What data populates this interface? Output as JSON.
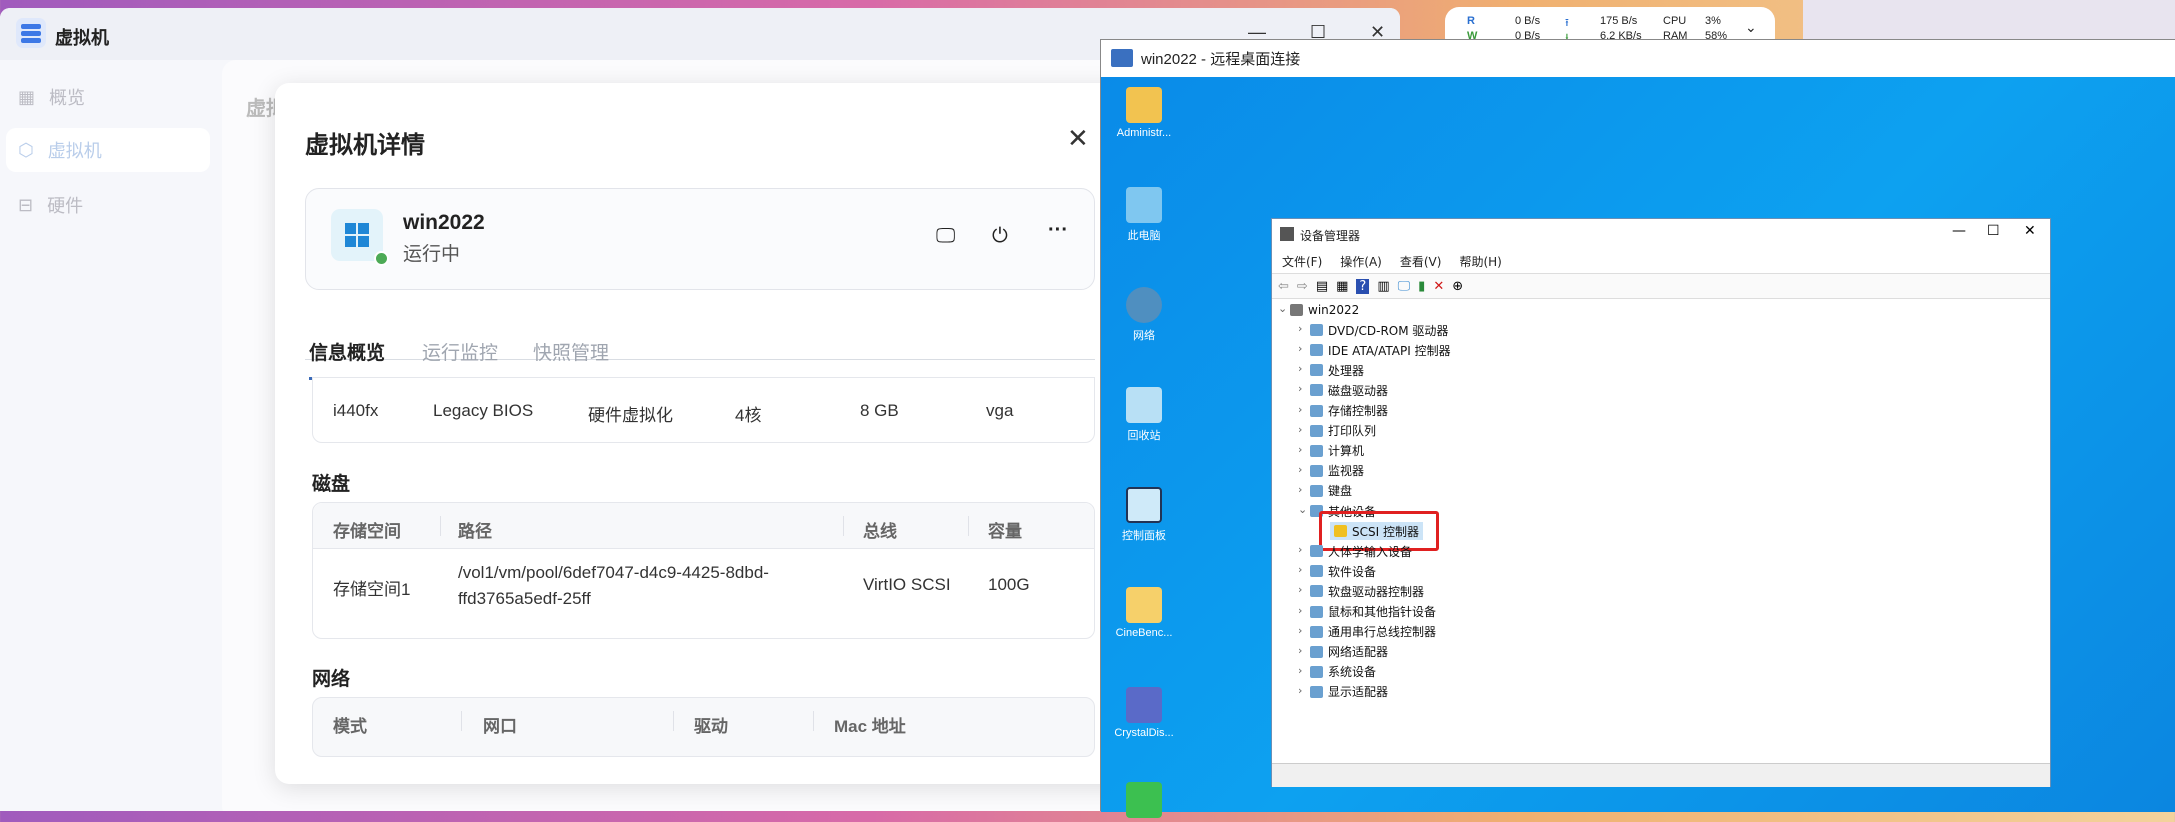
{
  "app": {
    "title": "虚拟机",
    "sidebar": [
      {
        "label": "概览",
        "icon": "grid-icon"
      },
      {
        "label": "虚拟机",
        "icon": "cube-icon",
        "active": true
      },
      {
        "label": "硬件",
        "icon": "drive-icon"
      }
    ],
    "bg_heading": "虚拟"
  },
  "modal": {
    "title": "虚拟机详情",
    "vm": {
      "name": "win2022",
      "status": "运行中",
      "status_color": "#4caa56"
    },
    "tabs": [
      "信息概览",
      "运行监控",
      "快照管理"
    ],
    "info": [
      "i440fx",
      "Legacy BIOS",
      "硬件虚拟化",
      "4核",
      "8 GB",
      "vga"
    ],
    "disk": {
      "title": "磁盘",
      "headers": [
        "存储空间",
        "路径",
        "总线",
        "容量"
      ],
      "rows": [
        {
          "storage": "存储空间1",
          "path1": "/vol1/vm/pool/6def7047-d4c9-4425-8dbd-",
          "path2": "ffd3765a5edf-25ff",
          "bus": "VirtIO SCSI",
          "size": "100G"
        }
      ]
    },
    "network": {
      "title": "网络",
      "headers": [
        "模式",
        "网口",
        "驱动",
        "Mac 地址"
      ]
    }
  },
  "netmon": {
    "r_label": "R",
    "w_label": "W",
    "r": "0 B/s",
    "w": "0 B/s",
    "up": "175 B/s",
    "down": "6.2 KB/s",
    "cpu_label": "CPU",
    "cpu": "3%",
    "ram_label": "RAM",
    "ram": "58%"
  },
  "rdp": {
    "title": "win2022 - 远程桌面连接",
    "desktop_icons": [
      "Administr...",
      "此电脑",
      "网络",
      "回收站",
      "控制面板",
      "CineBenc...",
      "CrystalDis..."
    ],
    "devmgr": {
      "title": "设备管理器",
      "menu": [
        "文件(F)",
        "操作(A)",
        "查看(V)",
        "帮助(H)"
      ],
      "root": "win2022",
      "items": [
        "DVD/CD-ROM 驱动器",
        "IDE ATA/ATAPI 控制器",
        "处理器",
        "磁盘驱动器",
        "存储控制器",
        "打印队列",
        "计算机",
        "监视器",
        "键盘",
        "其他设备",
        "人体学输入设备",
        "软件设备",
        "软盘驱动器控制器",
        "鼠标和其他指针设备",
        "通用串行总线控制器",
        "网络适配器",
        "系统设备",
        "显示适配器"
      ],
      "child": "SCSI 控制器"
    }
  }
}
